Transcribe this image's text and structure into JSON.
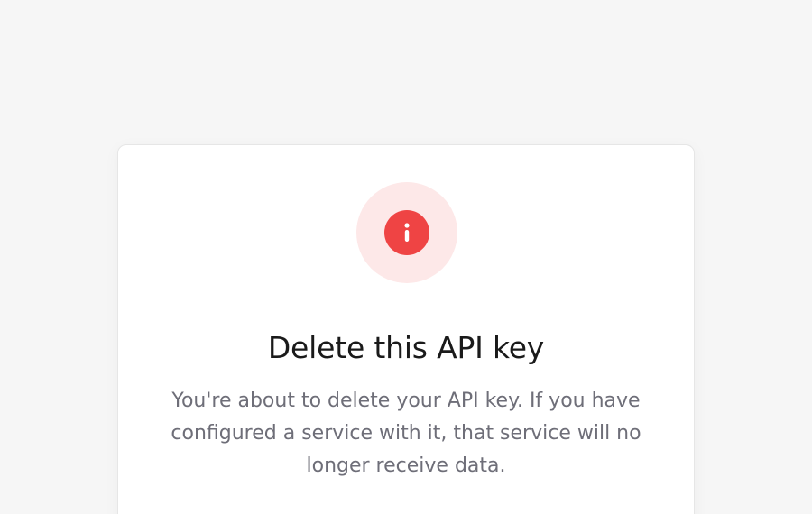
{
  "dialog": {
    "icon": "info-icon",
    "title": "Delete this API key",
    "message": "You're about to delete your API key. If you have configured a service with it, that service will no longer receive data."
  },
  "colors": {
    "background": "#f6f6f6",
    "card": "#ffffff",
    "accent": "#ef4444",
    "accent_soft": "#fde8e8",
    "title": "#1a1a1a",
    "body": "#6e6e78"
  }
}
